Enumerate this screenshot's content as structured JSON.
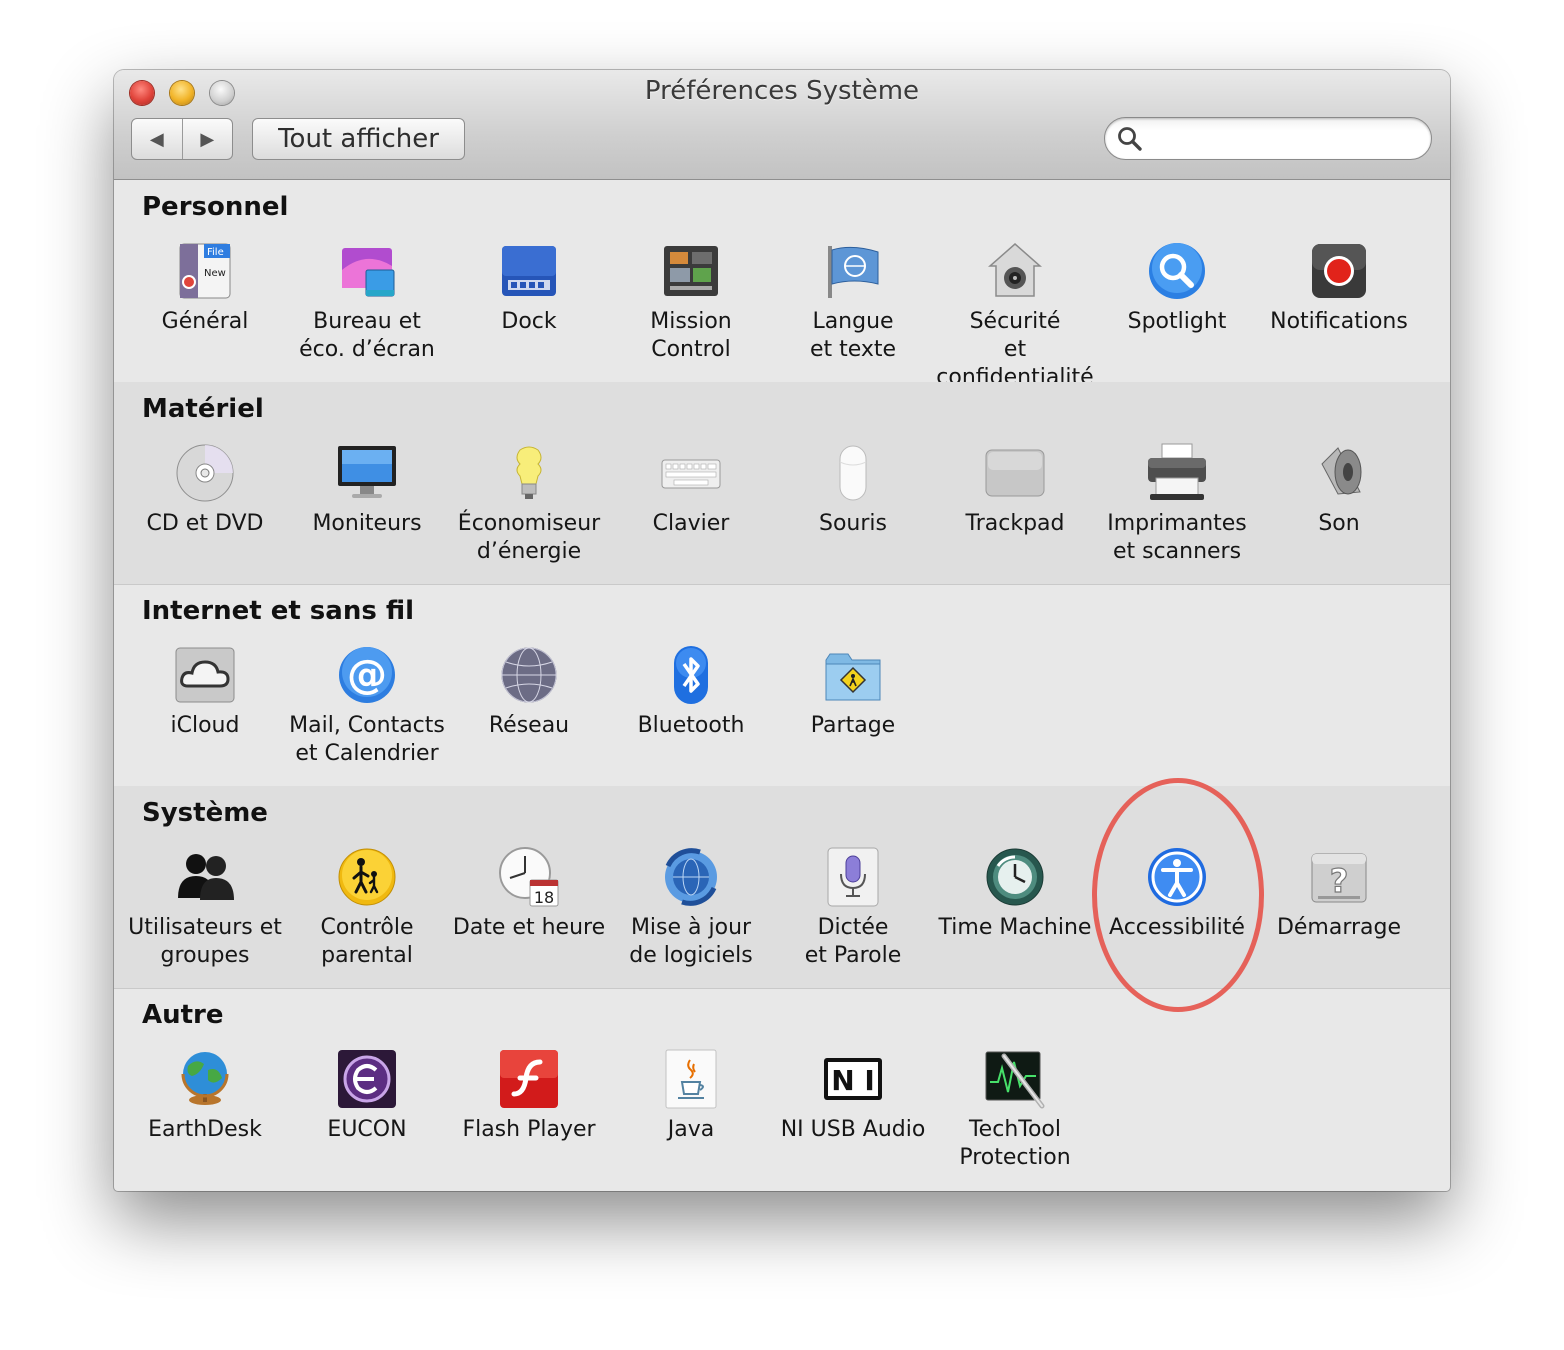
{
  "window": {
    "title": "Préférences Système",
    "show_all_label": "Tout afficher",
    "back_glyph": "◀",
    "forward_glyph": "▶",
    "search_placeholder": ""
  },
  "sections": [
    {
      "title": "Personnel",
      "items": [
        {
          "label": "Général",
          "icon": "general-icon"
        },
        {
          "label": "Bureau et\néco. d’écran",
          "icon": "desktop-screensaver-icon"
        },
        {
          "label": "Dock",
          "icon": "dock-icon"
        },
        {
          "label": "Mission\nControl",
          "icon": "mission-control-icon"
        },
        {
          "label": "Langue\net texte",
          "icon": "language-flag-icon"
        },
        {
          "label": "Sécurité\net confidentialité",
          "icon": "security-house-icon"
        },
        {
          "label": "Spotlight",
          "icon": "spotlight-icon"
        },
        {
          "label": "Notifications",
          "icon": "notifications-icon"
        }
      ]
    },
    {
      "title": "Matériel",
      "items": [
        {
          "label": "CD et DVD",
          "icon": "cd-dvd-icon"
        },
        {
          "label": "Moniteurs",
          "icon": "monitor-icon"
        },
        {
          "label": "Économiseur\nd’énergie",
          "icon": "energy-bulb-icon"
        },
        {
          "label": "Clavier",
          "icon": "keyboard-icon"
        },
        {
          "label": "Souris",
          "icon": "mouse-icon"
        },
        {
          "label": "Trackpad",
          "icon": "trackpad-icon"
        },
        {
          "label": "Imprimantes\net scanners",
          "icon": "printer-icon"
        },
        {
          "label": "Son",
          "icon": "speaker-icon"
        }
      ]
    },
    {
      "title": "Internet et sans fil",
      "items": [
        {
          "label": "iCloud",
          "icon": "icloud-icon"
        },
        {
          "label": "Mail, Contacts\net Calendrier",
          "icon": "mail-at-icon"
        },
        {
          "label": "Réseau",
          "icon": "network-globe-icon"
        },
        {
          "label": "Bluetooth",
          "icon": "bluetooth-icon"
        },
        {
          "label": "Partage",
          "icon": "sharing-folder-icon"
        }
      ]
    },
    {
      "title": "Système",
      "items": [
        {
          "label": "Utilisateurs et\ngroupes",
          "icon": "users-icon"
        },
        {
          "label": "Contrôle\nparental",
          "icon": "parental-controls-icon"
        },
        {
          "label": "Date et heure",
          "icon": "clock-calendar-icon"
        },
        {
          "label": "Mise à jour\nde logiciels",
          "icon": "software-update-icon"
        },
        {
          "label": "Dictée\net Parole",
          "icon": "microphone-icon"
        },
        {
          "label": "Time Machine",
          "icon": "time-machine-icon"
        },
        {
          "label": "Accessibilité",
          "icon": "accessibility-icon"
        },
        {
          "label": "Démarrage",
          "icon": "startup-disk-icon"
        }
      ]
    },
    {
      "title": "Autre",
      "items": [
        {
          "label": "EarthDesk",
          "icon": "earth-globe-icon"
        },
        {
          "label": "EUCON",
          "icon": "eucon-icon"
        },
        {
          "label": "Flash Player",
          "icon": "flash-icon"
        },
        {
          "label": "Java",
          "icon": "java-cup-icon"
        },
        {
          "label": "NI USB Audio",
          "icon": "ni-logo-icon"
        },
        {
          "label": "TechTool\nProtection",
          "icon": "techtool-icon"
        }
      ]
    }
  ],
  "colors": {
    "highlight_ring": "#e6534a",
    "window_bg": "#e8e8e8",
    "alt_section_bg": "#dedede"
  }
}
